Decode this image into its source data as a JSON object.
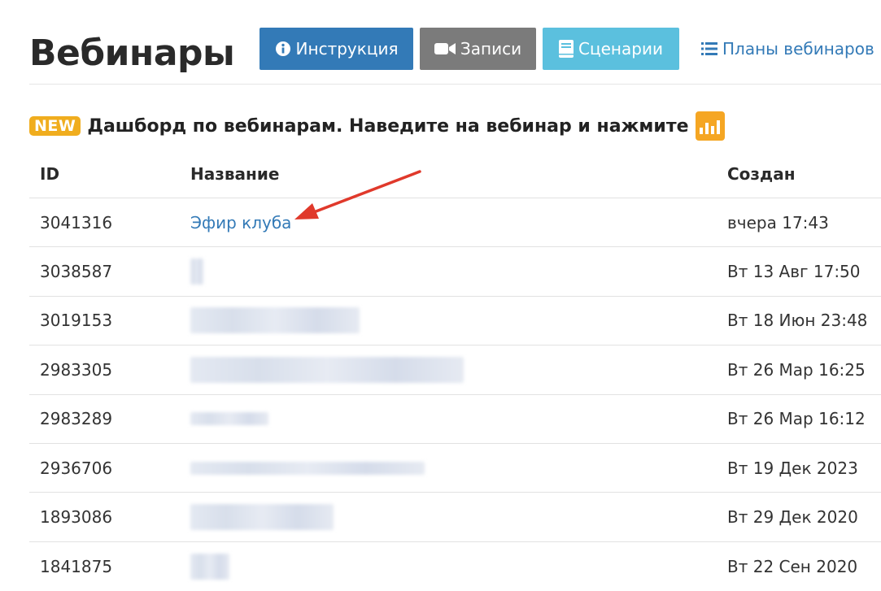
{
  "header": {
    "title": "Вебинары",
    "buttons": {
      "instructions": "Инструкция",
      "recordings": "Записи",
      "scenarios": "Сценарии"
    },
    "plans_link": "Планы вебинаров"
  },
  "notice": {
    "badge": "NEW",
    "text": "Дашборд по вебинарам. Наведите на вебинар и нажмите"
  },
  "table": {
    "columns": {
      "id": "ID",
      "name": "Название",
      "created": "Создан"
    },
    "rows": [
      {
        "id": "3041316",
        "name": "Эфир клуба",
        "created": "вчера 17:43"
      },
      {
        "id": "3038587",
        "name": "",
        "created": "Вт 13 Авг 17:50"
      },
      {
        "id": "3019153",
        "name": "",
        "created": "Вт 18 Июн 23:48"
      },
      {
        "id": "2983305",
        "name": "",
        "created": "Вт 26 Мар 16:25"
      },
      {
        "id": "2983289",
        "name": "",
        "created": "Вт 26 Мар 16:12"
      },
      {
        "id": "2936706",
        "name": "",
        "created": "Вт 19 Дек 2023"
      },
      {
        "id": "1893086",
        "name": "",
        "created": "Вт 29 Дек 2020"
      },
      {
        "id": "1841875",
        "name": "",
        "created": "Вт 22 Сен 2020"
      }
    ]
  },
  "colors": {
    "primary": "#337ab7",
    "recordings": "#7b7b7b",
    "scenarios": "#5bc0de",
    "badge": "#f0ad1e",
    "arrow": "#e0392b"
  },
  "icons": {
    "instructions": "info-circle-icon",
    "recordings": "video-camera-icon",
    "scenarios": "book-icon",
    "plans": "list-icon",
    "dashboard": "bar-chart-icon"
  }
}
